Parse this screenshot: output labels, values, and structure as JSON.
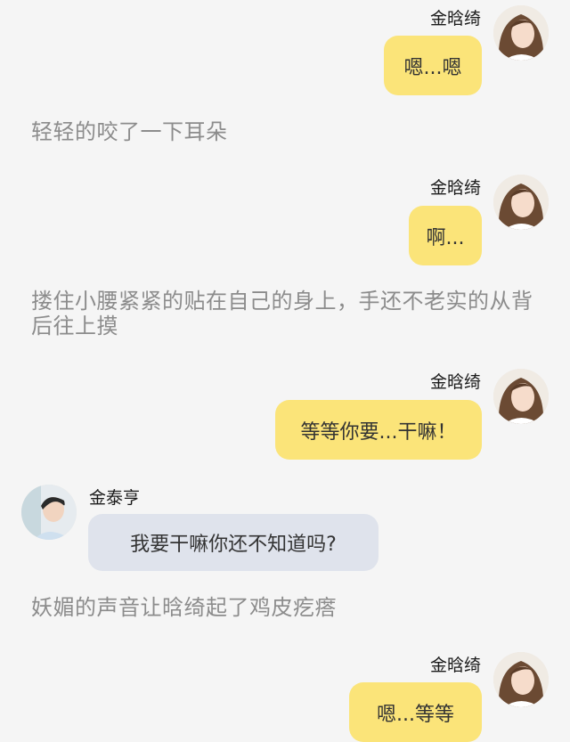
{
  "messages": [
    {
      "type": "right",
      "sender": "金晗绮",
      "text": "嗯...嗯"
    },
    {
      "type": "narration",
      "text": "轻轻的咬了一下耳朵"
    },
    {
      "type": "right",
      "sender": "金晗绮",
      "text": "啊..."
    },
    {
      "type": "narration",
      "text": "搂住小腰紧紧的贴在自己的身上，手还不老实的从背后往上摸"
    },
    {
      "type": "right",
      "sender": "金晗绮",
      "text": "等等你要...干嘛！"
    },
    {
      "type": "left",
      "sender": "金泰亨",
      "text": "我要干嘛你还不知道吗?"
    },
    {
      "type": "narration",
      "text": "妖媚的声音让晗绮起了鸡皮疙瘩"
    },
    {
      "type": "right",
      "sender": "金晗绮",
      "text": "嗯...等等"
    }
  ],
  "colors": {
    "background": "#f5f5f5",
    "bubble_self": "#fbe479",
    "bubble_other": "#dfe3ec",
    "narration_text": "#8c8c8c"
  },
  "icons": {
    "self_avatar": "avatar-girl-icon",
    "other_avatar": "avatar-boy-icon"
  }
}
